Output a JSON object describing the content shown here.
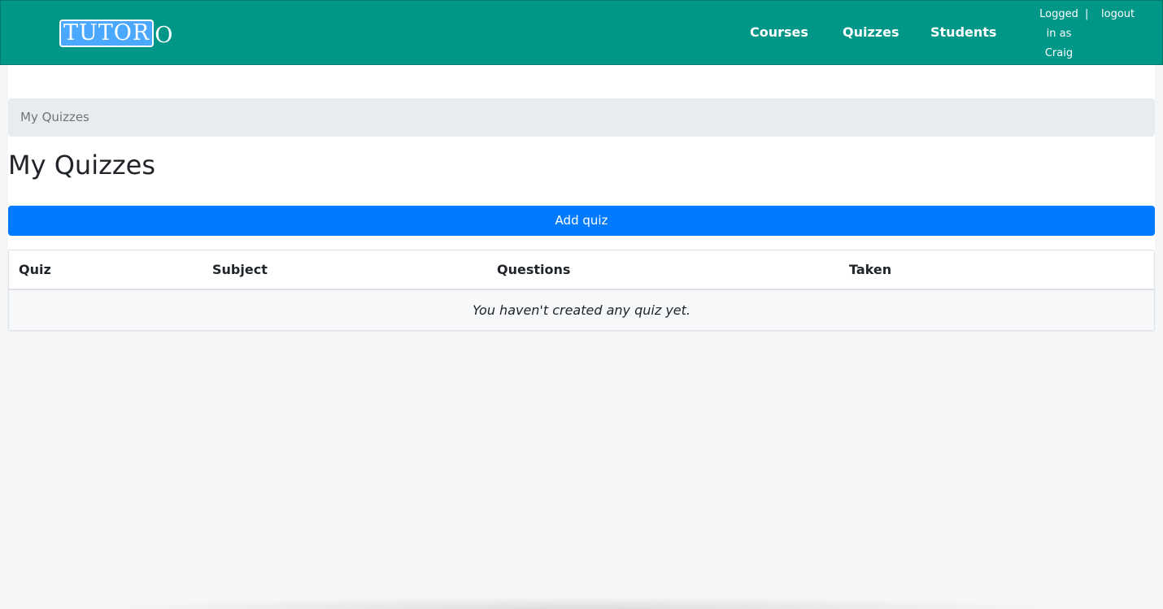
{
  "brand": {
    "logo_boxed": "TUTOR",
    "logo_tail": "O"
  },
  "nav": {
    "links": [
      "Courses",
      "Quizzes",
      "Students"
    ],
    "user_info": "Logged in as Craig",
    "separator": "|",
    "logout": "logout"
  },
  "breadcrumb": {
    "current": "My Quizzes"
  },
  "page": {
    "title": "My Quizzes"
  },
  "actions": {
    "add_quiz": "Add quiz"
  },
  "table": {
    "columns": [
      "Quiz",
      "Subject",
      "Questions",
      "Taken"
    ],
    "empty_message": "You haven't created any quiz yet."
  },
  "colors": {
    "navbar": "#009688",
    "logo_box": "#4aa8ff",
    "primary_button": "#007bff",
    "breadcrumb_bg": "#e9ecef",
    "page_bg": "#f5f6f8"
  }
}
